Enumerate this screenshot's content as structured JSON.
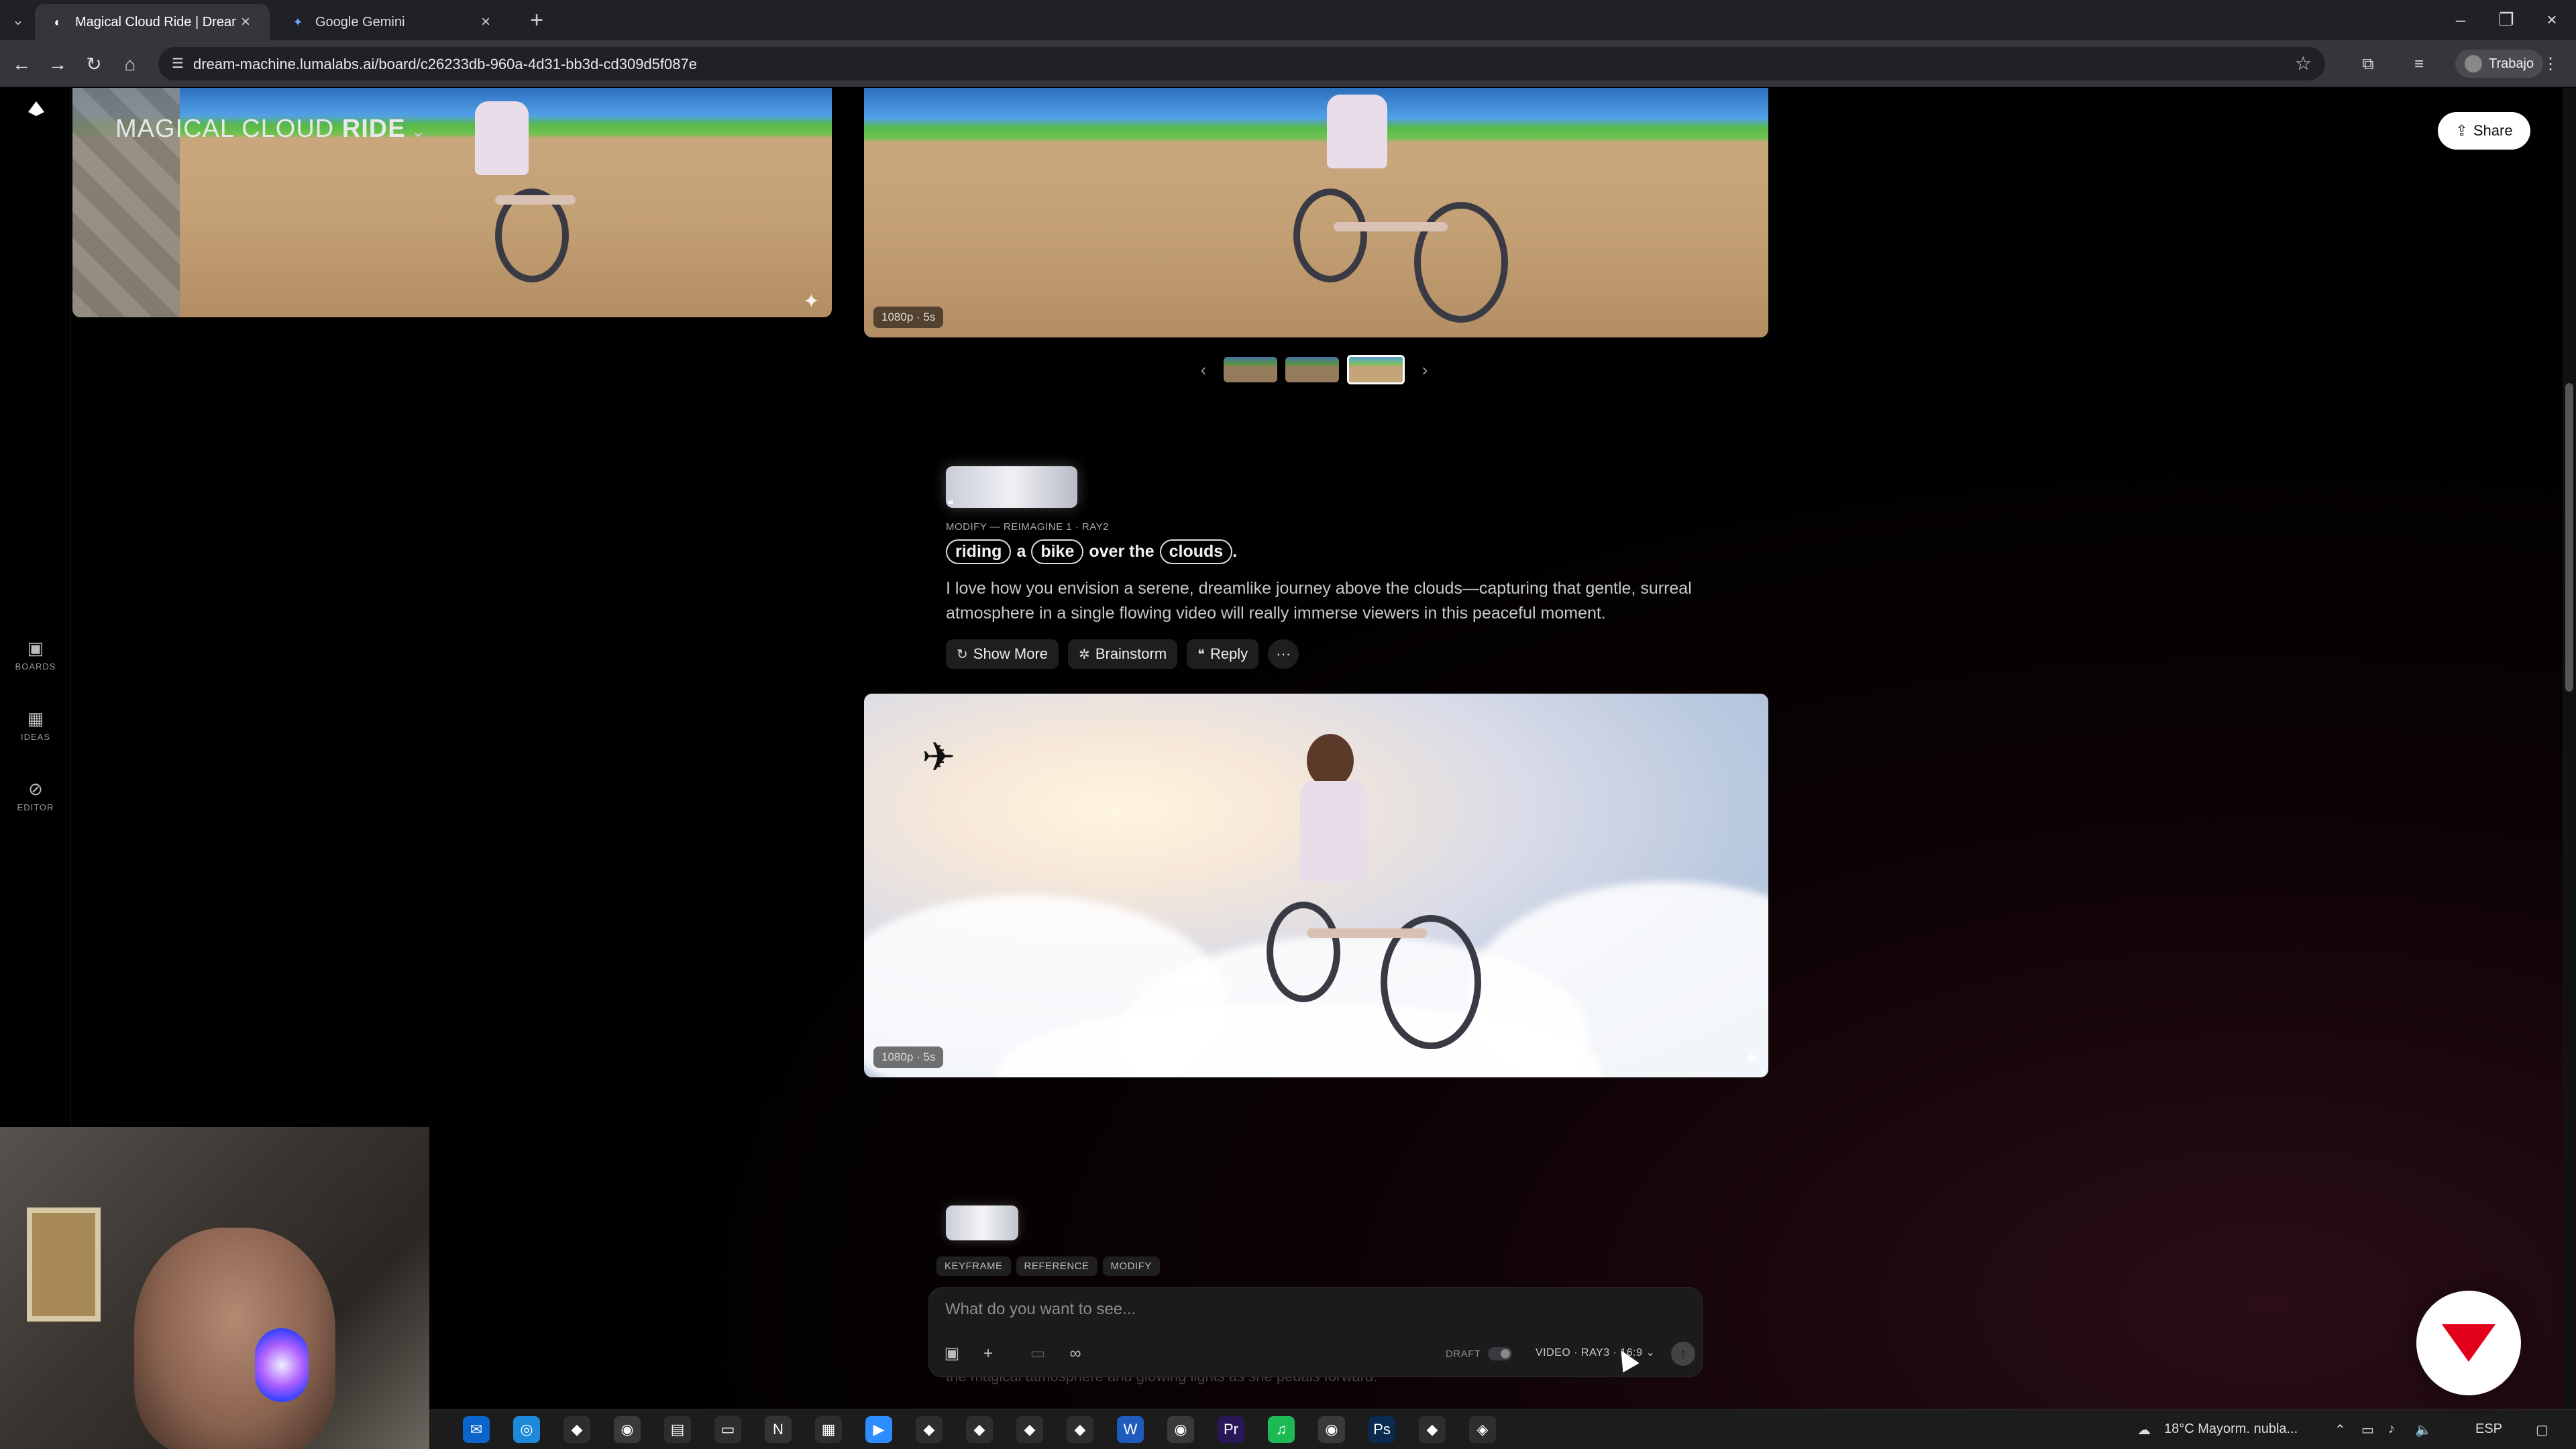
{
  "browser": {
    "tabs": [
      {
        "title": "Magical Cloud Ride | Dream M",
        "favicon": "luma-icon",
        "active": true
      },
      {
        "title": "Google Gemini",
        "favicon": "gemini-sparkle-icon",
        "active": false
      }
    ],
    "url": "dream-machine.lumalabs.ai/board/c26233db-960a-4d31-bb3d-cd309d5f087e",
    "profile_label": "Trabajo"
  },
  "app": {
    "board_title_light": "MAGICAL CLOUD ",
    "board_title_bold": "RIDE",
    "share_label": "Share",
    "rail": [
      {
        "label": "BOARDS",
        "icon": "boards-icon"
      },
      {
        "label": "IDEAS",
        "icon": "ideas-icon"
      },
      {
        "label": "EDITOR",
        "icon": "editor-icon"
      }
    ],
    "video_badges": {
      "top": "1080p · 5s",
      "main": "1080p · 5s"
    },
    "generation": {
      "meta": "MODIFY — REIMAGINE 1 · RAY2",
      "prompt_parts": [
        {
          "text": "riding",
          "chip": true
        },
        {
          "text": "a",
          "chip": false
        },
        {
          "text": "bike",
          "chip": true
        },
        {
          "text": "over the",
          "chip": false
        },
        {
          "text": "clouds",
          "chip": true
        },
        {
          "text": ".",
          "chip": false
        }
      ],
      "description": "I love how you envision a serene, dreamlike journey above the clouds—capturing that gentle, surreal atmosphere in a single flowing video will really immerse viewers in this peaceful moment.",
      "actions": {
        "show_more": "Show More",
        "brainstorm": "Brainstorm",
        "reply": "Reply",
        "more": "···"
      }
    },
    "mode_tabs": [
      "KEYFRAME",
      "REFERENCE",
      "MODIFY"
    ],
    "composer": {
      "placeholder": "What do you want to see...",
      "draft_label": "DRAFT",
      "model_label": "VIDEO · RAY3 · 16:9"
    },
    "partial_text": "the magical atmosphere and glowing lights as she pedals forward."
  },
  "taskbar": {
    "weather": "18°C  Mayorm. nubla...",
    "lang": "ESP",
    "apps": [
      "outlook-icon",
      "edge-icon",
      "app-icon",
      "chrome-icon",
      "store-icon",
      "explorer-icon",
      "notion-icon",
      "calendar-icon",
      "zoom-icon",
      "app-icon",
      "app-icon",
      "app-icon",
      "app-icon",
      "word-icon",
      "chrome-icon",
      "premiere-icon",
      "spotify-icon",
      "chrome-icon",
      "photoshop-icon",
      "app-icon",
      "davinci-icon"
    ]
  },
  "colors": {
    "accent_red": "#e3001b",
    "tab_active": "#35363a",
    "toolbar": "#35363a"
  }
}
